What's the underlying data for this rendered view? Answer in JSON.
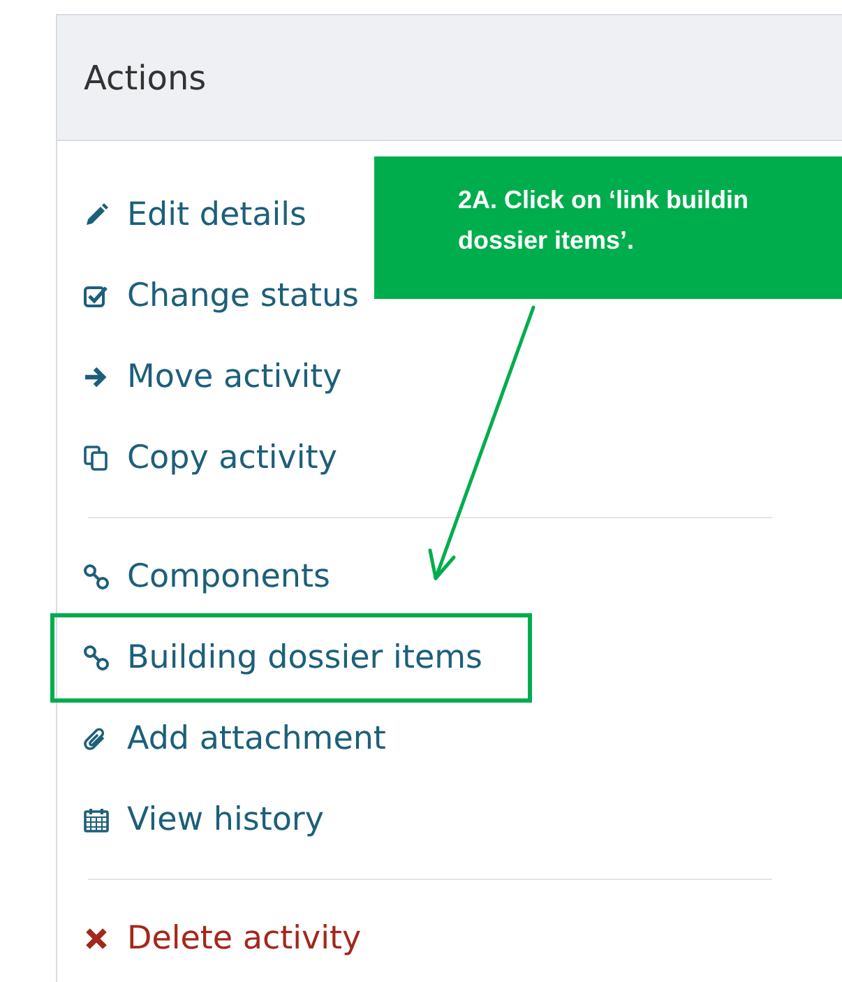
{
  "panel": {
    "title": "Actions",
    "sections": [
      [
        {
          "label": "Edit details",
          "kind": "normal",
          "highlighted": false
        },
        {
          "label": "Change status",
          "kind": "normal",
          "highlighted": false
        },
        {
          "label": "Move activity",
          "kind": "normal",
          "highlighted": false
        },
        {
          "label": "Copy activity",
          "kind": "normal",
          "highlighted": false
        }
      ],
      [
        {
          "label": "Components",
          "kind": "normal",
          "highlighted": false
        },
        {
          "label": "Building dossier items",
          "kind": "normal",
          "highlighted": true
        },
        {
          "label": "Add attachment",
          "kind": "normal",
          "highlighted": false
        },
        {
          "label": "View history",
          "kind": "normal",
          "highlighted": false
        }
      ],
      [
        {
          "label": "Delete activity",
          "kind": "danger",
          "highlighted": false
        }
      ]
    ]
  },
  "callout": {
    "lines": [
      "2A. Click on ‘link buildin",
      "dossier items’."
    ]
  }
}
